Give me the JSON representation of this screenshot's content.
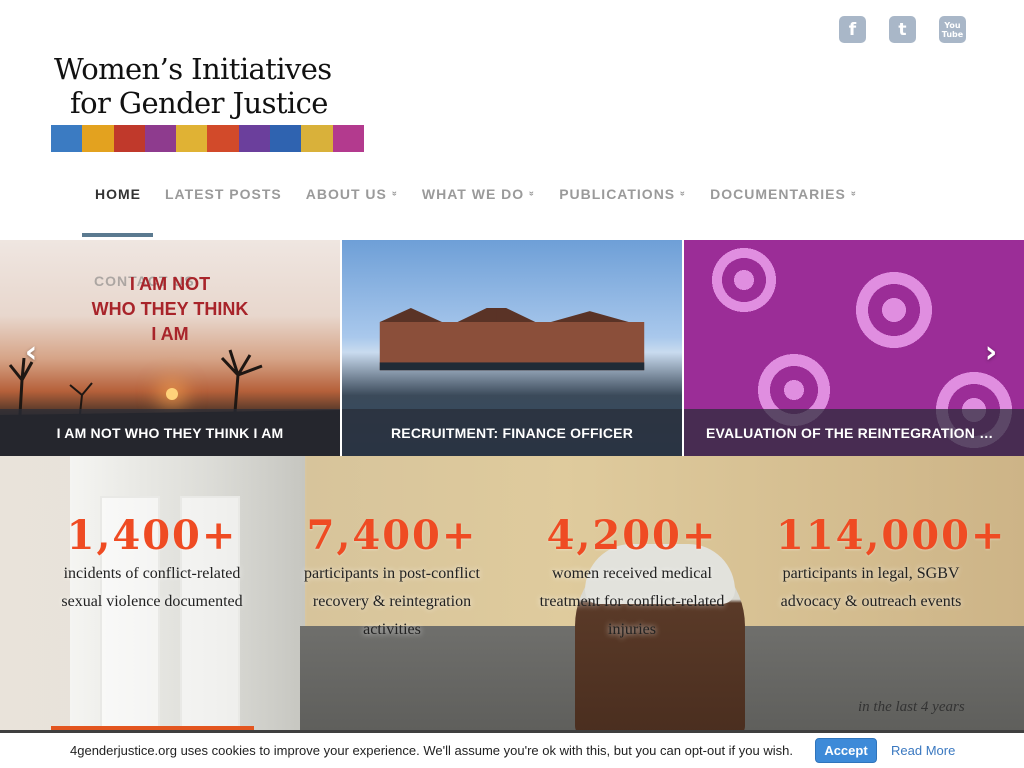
{
  "social": {
    "facebook_glyph": "f",
    "twitter_glyph": "t",
    "youtube_glyph_top": "You",
    "youtube_glyph_bottom": "Tube",
    "icon_color": "#a9b7c8"
  },
  "logo": {
    "line1": "Women’s Initiatives",
    "line2": "for Gender Justice",
    "fabric_colors": [
      "#3b7bc2",
      "#e3a21f",
      "#c0392b",
      "#8e3b8e",
      "#e0b234",
      "#d24a2a",
      "#6b3f9c",
      "#2f63b0",
      "#d9b13a",
      "#b33a8e"
    ]
  },
  "nav": {
    "items": [
      {
        "label": "HOME",
        "active": true,
        "has_dropdown": false
      },
      {
        "label": "LATEST POSTS",
        "active": false,
        "has_dropdown": false
      },
      {
        "label": "ABOUT US",
        "active": false,
        "has_dropdown": true
      },
      {
        "label": "WHAT WE DO",
        "active": false,
        "has_dropdown": true
      },
      {
        "label": "PUBLICATIONS",
        "active": false,
        "has_dropdown": true
      },
      {
        "label": "DOCUMENTARIES",
        "active": false,
        "has_dropdown": true
      }
    ],
    "dropdown_glyph": "»",
    "active_color": "#333333",
    "inactive_color": "#9a9a9a",
    "active_bar_color": "#5b7a90"
  },
  "carousel": {
    "ghost_text": "CONTACT US",
    "poster_text_line1": "I AM NOT",
    "poster_text_line2": "WHO THEY THINK",
    "poster_text_line3": "I AM",
    "prev_glyph": "‹",
    "next_glyph": "›",
    "slides": [
      {
        "caption": "I AM NOT WHO THEY THINK I AM"
      },
      {
        "caption": "RECRUITMENT: FINANCE OFFICER"
      },
      {
        "caption": "EVALUATION OF THE REINTEGRATION PROGRAMME"
      }
    ]
  },
  "stats": {
    "accent_color": "#ef4b23",
    "items": [
      {
        "number": "1,400+",
        "description": "incidents of conflict-related sexual violence documented"
      },
      {
        "number": "7,400+",
        "description": "participants in post-conflict recovery & reintegration activities"
      },
      {
        "number": "4,200+",
        "description": "women received medical treatment for conflict-related injuries"
      },
      {
        "number": "114,000+",
        "description": "participants in legal, SGBV advocacy & outreach events"
      }
    ],
    "period": "in the last 4 years"
  },
  "cookie": {
    "message": "4genderjustice.org uses cookies to improve your experience. We'll assume you're ok with this, but you can opt-out if you wish.",
    "accept_label": "Accept",
    "read_more_label": "Read More"
  }
}
